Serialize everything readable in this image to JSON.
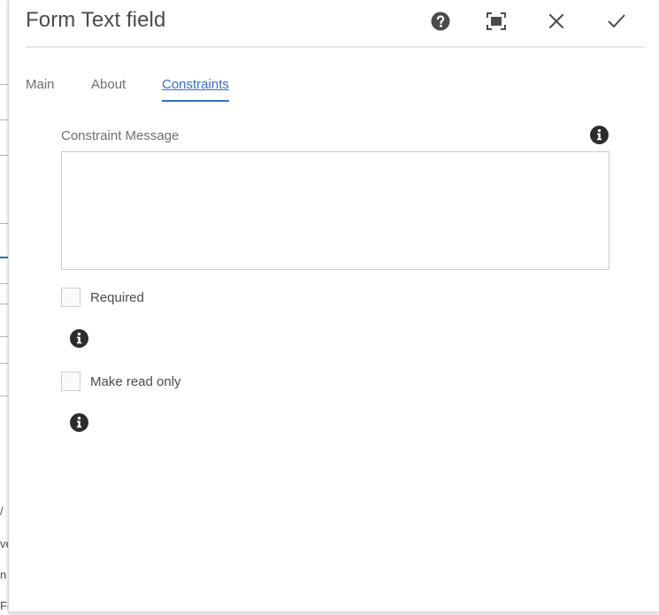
{
  "dialog": {
    "title": "Form Text field",
    "header_buttons": {
      "help_icon": "help-circle-icon",
      "fullscreen_icon": "fullscreen-icon",
      "close_icon": "close-icon",
      "done_icon": "checkmark-icon"
    }
  },
  "tabs": [
    {
      "label": "Main",
      "active": false
    },
    {
      "label": "About",
      "active": false
    },
    {
      "label": "Constraints",
      "active": true
    }
  ],
  "constraints": {
    "constraint_message": {
      "label": "Constraint Message",
      "value": ""
    },
    "required": {
      "label": "Required",
      "checked": false
    },
    "read_only": {
      "label": "Make read only",
      "checked": false
    }
  },
  "background_fragments": [
    "/",
    "ve",
    "n",
    "Fi"
  ],
  "colors": {
    "accent": "#326ec8",
    "text": "#4b4b4b",
    "muted_text": "#6e6e6e",
    "icon": "#2c2c2c"
  }
}
